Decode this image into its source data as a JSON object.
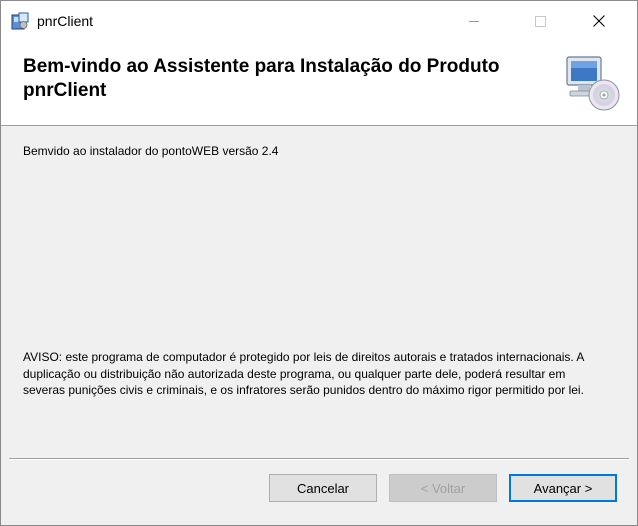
{
  "window": {
    "title": "pnrClient"
  },
  "banner": {
    "title": "Bem-vindo ao Assistente para Instalação do Produto pnrClient"
  },
  "content": {
    "welcome": "Bemvido ao instalador do pontoWEB versão 2.4",
    "warning": "AVISO: este programa de computador é protegido por leis de direitos autorais e tratados internacionais. A duplicação ou distribuição não autorizada deste programa, ou qualquer parte dele, poderá resultar em severas punições civis e criminais, e os infratores serão punidos dentro do máximo rigor permitido por lei."
  },
  "buttons": {
    "cancel": "Cancelar",
    "back": "< Voltar",
    "next": "Avançar >"
  },
  "icons": {
    "app": "installer-icon",
    "banner": "computer-cd-icon",
    "minimize": "minimize-icon",
    "maximize": "maximize-icon",
    "close": "close-icon"
  },
  "colors": {
    "focus_border": "#0078d7",
    "disabled_text": "#a0a0a0"
  }
}
